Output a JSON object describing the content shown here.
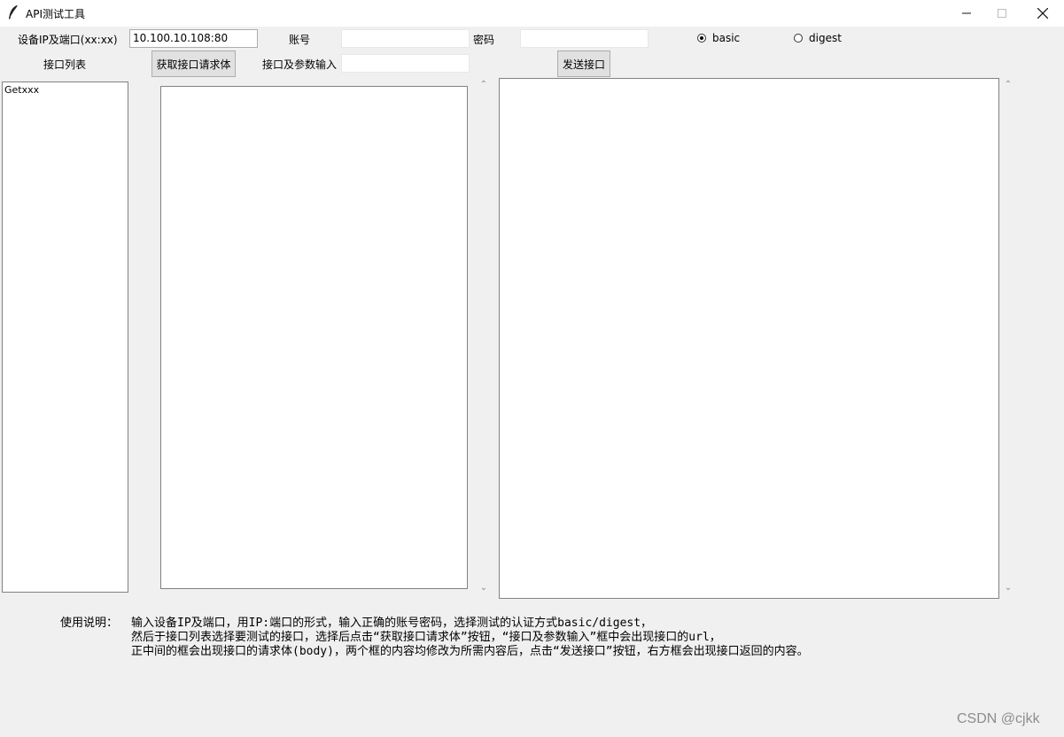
{
  "window": {
    "title": "API测试工具",
    "minimize_icon": "minimize-icon",
    "maximize_icon": "maximize-icon",
    "close_icon": "close-icon"
  },
  "form": {
    "ip_label": "设备IP及端口(xx:xx)",
    "ip_value": "10.100.10.108:80",
    "account_label": "账号",
    "account_value": "",
    "password_label": "密码",
    "password_value": "",
    "auth": {
      "options": [
        "basic",
        "digest"
      ],
      "selected": "basic"
    }
  },
  "toolbar": {
    "api_list_label": "接口列表",
    "get_body_button": "获取接口请求体",
    "api_param_label": "接口及参数输入",
    "api_param_value": "",
    "send_button": "发送接口"
  },
  "api_list": {
    "items": [
      "Getxxx"
    ]
  },
  "instructions": {
    "prefix": "使用说明：",
    "lines": [
      "输入设备IP及端口，用IP:端口的形式，输入正确的账号密码，选择测试的认证方式basic/digest，",
      "然后于接口列表选择要测试的接口，选择后点击“获取接口请求体”按钮，“接口及参数输入”框中会出现接口的url，",
      "正中间的框会出现接口的请求体(body)，两个框的内容均修改为所需内容后，点击“发送接口”按钮，右方框会出现接口返回的内容。"
    ]
  },
  "watermark": "CSDN @cjkk",
  "scrollbar": {
    "up_glyph": "⌃",
    "down_glyph": "⌄"
  }
}
